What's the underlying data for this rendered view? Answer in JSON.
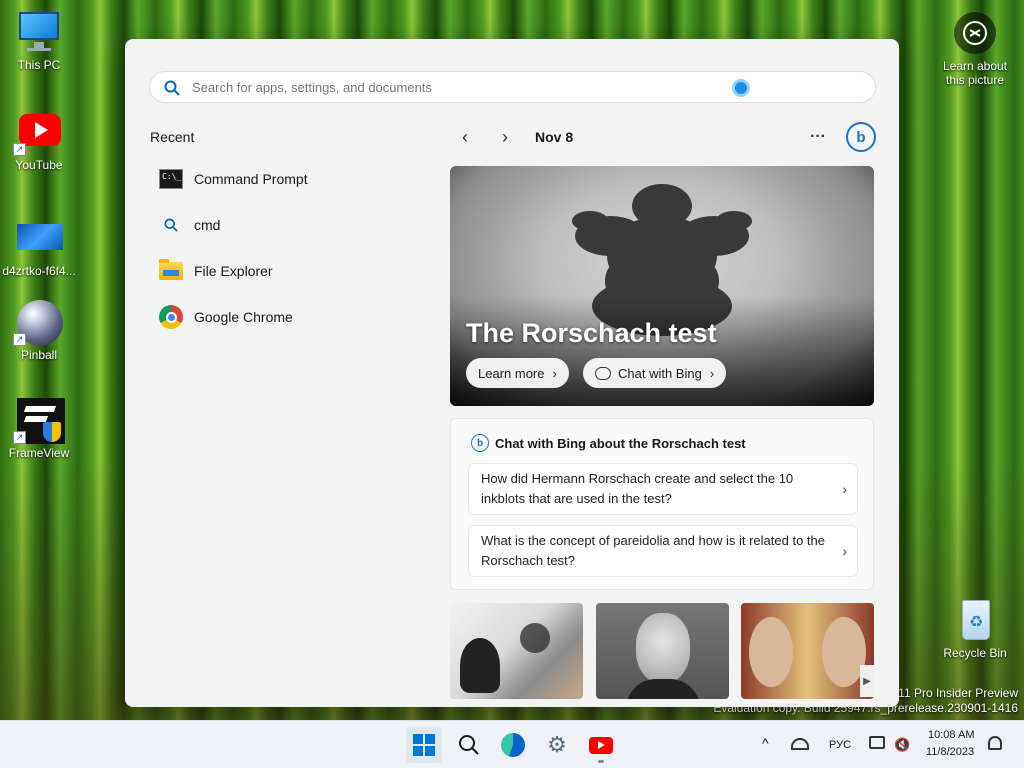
{
  "desktop": {
    "icons": [
      {
        "label": "This PC"
      },
      {
        "label": "YouTube"
      },
      {
        "label": "d4zrtko-f6f4..."
      },
      {
        "label": "Pinball"
      },
      {
        "label": "FrameView"
      },
      {
        "label": "Recycle Bin"
      }
    ],
    "learn_about": "Learn about this picture",
    "watermark_line1": "11 Pro Insider Preview",
    "watermark_line2": "Evaluation copy. Build 25947.rs_prerelease.230901-1416"
  },
  "start": {
    "search_placeholder": "Search for apps, settings, and documents",
    "recent_title": "Recent",
    "recent_items": [
      {
        "label": "Command Prompt",
        "icon": "command-prompt-icon"
      },
      {
        "label": "cmd",
        "icon": "search-icon"
      },
      {
        "label": "File Explorer",
        "icon": "folder-icon"
      },
      {
        "label": "Google Chrome",
        "icon": "chrome-icon"
      }
    ],
    "date": "Nov 8",
    "more": "···",
    "hero": {
      "title": "The Rorschach test",
      "learn_more": "Learn more",
      "chat_with_bing": "Chat with Bing"
    },
    "chat_card": {
      "title": "Chat with Bing about the Rorschach test",
      "questions": [
        "How did Hermann Rorschach create and select the 10 inkblots that are used in the test?",
        "What is the concept of pareidolia and how is it related to the Rorschach test?"
      ]
    }
  },
  "taskbar": {
    "language": "РУС",
    "time": "10:08 AM",
    "date": "11/8/2023"
  },
  "colors": {
    "accent": "#0067c0",
    "youtube_red": "#ff0000",
    "bing_blue": "#1a73c8"
  }
}
